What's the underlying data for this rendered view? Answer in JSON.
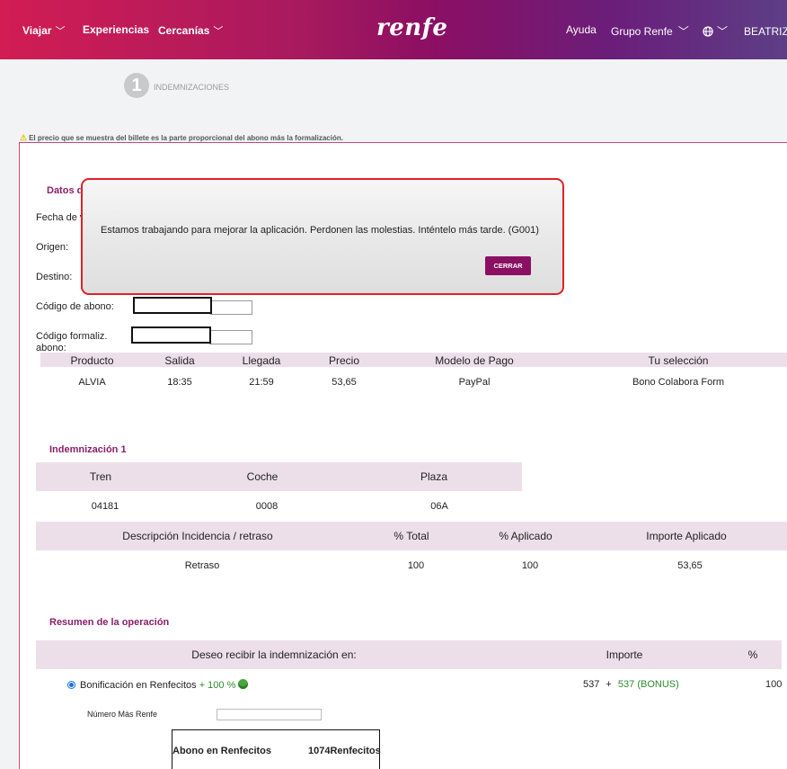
{
  "header": {
    "nav_left": [
      {
        "label": "Viajar",
        "chevron": true
      },
      {
        "label": "Experiencias",
        "chevron": false
      },
      {
        "label": "Cercanías",
        "chevron": true
      }
    ],
    "logo": "renfe",
    "nav_right": {
      "help": "Ayuda",
      "group": "Grupo Renfe",
      "language_icon": "globe-icon",
      "user": "BEATRIZ"
    }
  },
  "stepper": {
    "number": "1",
    "label": "INDEMNIZACIONES"
  },
  "warning": "El precio que se muestra del billete es la parte proporcional del abono más la formalización.",
  "datos": {
    "title_partial": "Datos d",
    "labels": {
      "fecha": "Fecha de v",
      "origen": "Origen:",
      "destino": "Destino:",
      "codigo_abono": "Código de abono:",
      "codigo_formaliz_1": "Código formaliz.",
      "codigo_formaliz_2": "abono:"
    }
  },
  "trip_table": {
    "headers": [
      "Producto",
      "Salida",
      "Llegada",
      "Precio",
      "Modelo de Pago",
      "Tu selección"
    ],
    "row": [
      "ALVIA",
      "18:35",
      "21:59",
      "53,65",
      "PayPal",
      "Bono Colabora Form"
    ]
  },
  "indemnizacion": {
    "title": "Indemnización 1",
    "train_headers": [
      "Tren",
      "Coche",
      "Plaza"
    ],
    "train_row": [
      "04181",
      "0008",
      "06A"
    ],
    "incident_headers": [
      "Descripción Incidencia / retraso",
      "% Total",
      "% Aplicado",
      "Importe Aplicado"
    ],
    "incident_row": [
      "Retraso",
      "100",
      "100",
      "53,65"
    ]
  },
  "resumen": {
    "title": "Resumen de la operación",
    "headers": {
      "receive": "Deseo recibir la indemnización  en:",
      "amount": "Importe",
      "percent": "%"
    },
    "option": {
      "label": "Bonificación en Renfecitos",
      "bonus_pct": "+ 100 %",
      "amount_base": "537",
      "plus": "+",
      "amount_bonus": "537 (BONUS)",
      "percent": "100"
    },
    "mas_renfe_label": "Número Más Renfe",
    "mas_renfe_value": "",
    "box_label": "Abono en Renfecitos",
    "box_value": "1074Renfecitos"
  },
  "modal": {
    "message": "Estamos trabajando para mejorar la aplicación. Perdonen las molestias. Inténtelo más tarde. (G001)",
    "button": "CERRAR"
  }
}
